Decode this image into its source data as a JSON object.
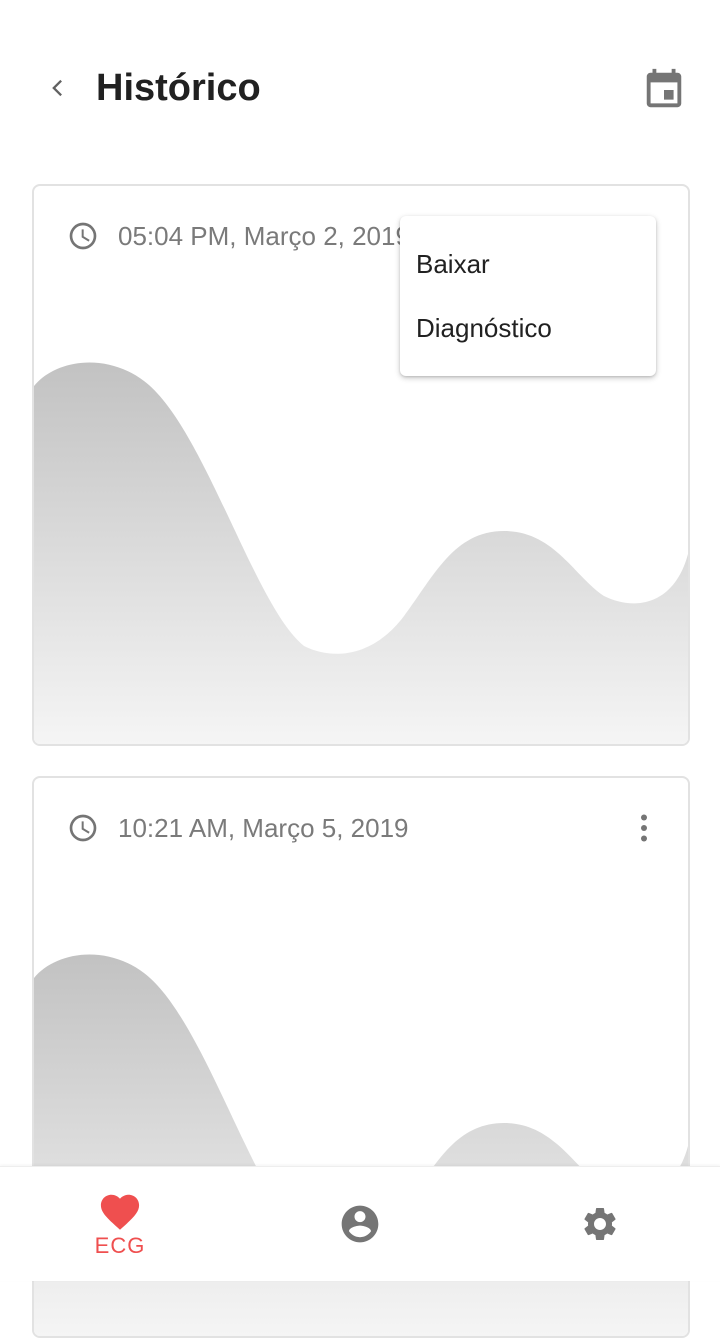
{
  "header": {
    "title": "Histórico",
    "back_icon": "chevron-left-icon",
    "calendar_icon": "calendar-today-icon"
  },
  "records": [
    {
      "time": "05:04 PM, Março 2, 2019"
    },
    {
      "time": "10:21 AM, Março 5, 2019"
    }
  ],
  "menu": {
    "items": [
      "Baixar",
      "Diagnóstico"
    ]
  },
  "bottom_nav": {
    "items": [
      {
        "label": "ECG",
        "icon": "heart-icon",
        "active": true
      },
      {
        "label": "",
        "icon": "account-circle-icon",
        "active": false
      },
      {
        "label": "",
        "icon": "settings-gear-icon",
        "active": false
      }
    ]
  },
  "colors": {
    "accent": "#ef4f4f",
    "icon_gray": "#757575",
    "text_gray": "#7a7a7a",
    "wave_top": "#c2c2c2",
    "wave_bottom": "#f5f5f5"
  }
}
